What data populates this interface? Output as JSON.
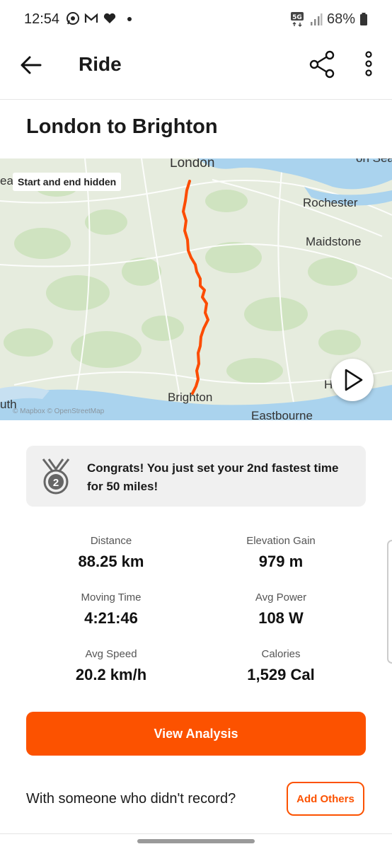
{
  "status_bar": {
    "time": "12:54",
    "battery": "68%",
    "left_icons": [
      "whatsapp-icon",
      "gmail-icon",
      "heart-icon",
      "dot-icon"
    ],
    "right_icons": [
      "5g-icon",
      "signal-icon",
      "battery-icon"
    ]
  },
  "header": {
    "title": "Ride",
    "icons": [
      "back-arrow-icon",
      "share-icon",
      "more-vertical-icon"
    ]
  },
  "activity": {
    "title": "London to Brighton"
  },
  "map": {
    "privacy_badge": "Start and end hidden",
    "labels": {
      "london": "London",
      "rochester": "Rochester",
      "maidstone": "Maidstone",
      "brighton": "Brighton",
      "eastbourne": "Eastbourne",
      "edge_left_top": "ea",
      "edge_left_bottom": "uth",
      "edge_right_top": "on Sea",
      "edge_right_mid": "H"
    },
    "attribution": "© Mapbox © OpenStreetMap",
    "route_color": "#fc4c02"
  },
  "achievement": {
    "icon": "medal-icon",
    "rank": "2",
    "text": "Congrats! You just set your 2nd fastest time for 50 miles!"
  },
  "stats": {
    "distance": {
      "label": "Distance",
      "value": "88.25 km"
    },
    "elevation": {
      "label": "Elevation Gain",
      "value": "979 m"
    },
    "moving_time": {
      "label": "Moving Time",
      "value": "4:21:46"
    },
    "avg_power": {
      "label": "Avg Power",
      "value": "108 W"
    },
    "avg_speed": {
      "label": "Avg Speed",
      "value": "20.2 km/h"
    },
    "calories": {
      "label": "Calories",
      "value": "1,529 Cal"
    }
  },
  "actions": {
    "view_analysis": "View Analysis",
    "prompt": "With someone who didn't record?",
    "add_others": "Add Others"
  },
  "colors": {
    "accent": "#fc5200",
    "map_land": "#e5ecdd",
    "map_water": "#aad3ee"
  }
}
